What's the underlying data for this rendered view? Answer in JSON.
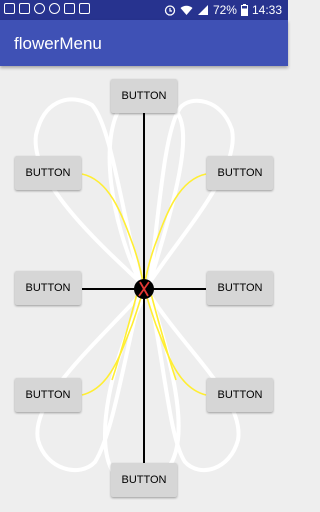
{
  "status_bar": {
    "battery": "72%",
    "time": "14:33"
  },
  "app_bar": {
    "title": "flowerMenu"
  },
  "menu": {
    "buttons": {
      "top": "BUTTON",
      "upper_left": "BUTTON",
      "upper_right": "BUTTON",
      "middle_left": "BUTTON",
      "middle_right": "BUTTON",
      "lower_left": "BUTTON",
      "lower_right": "BUTTON",
      "bottom": "BUTTON"
    },
    "colors": {
      "stem": "#000000",
      "petal_curve": "#ffee33",
      "petal_outline": "#ffffff",
      "center": "#000000",
      "center_mark": "#e53935"
    }
  }
}
